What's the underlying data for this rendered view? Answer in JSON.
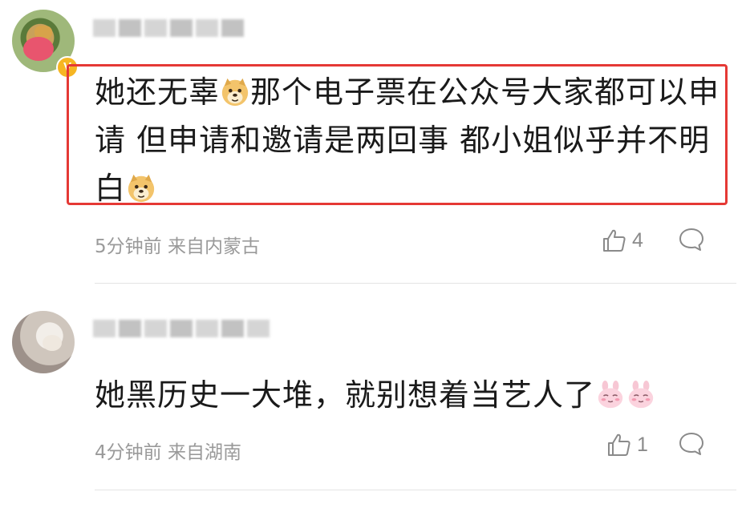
{
  "comments": [
    {
      "text_parts": [
        "她还无辜",
        "那个电子票在公众号大家都可以申请 但申请和邀请是两回事 都小姐似乎并不明白",
        ""
      ],
      "emoji": "doge-emoji",
      "vip_badge": "V",
      "time": "5分钟前",
      "location": "来自内蒙古",
      "likes": "4"
    },
    {
      "text": "她黑历史一大堆，就别想着当艺人了",
      "emoji": "pink-bunny-emoji",
      "time": "4分钟前",
      "location": "来自湖南",
      "likes": "1"
    }
  ],
  "colors": {
    "highlight": "#e53935",
    "meta_text": "#9a9a9a",
    "vip_badge": "#f6b623"
  },
  "icons": {
    "like": "thumbs-up-icon",
    "reply": "speech-bubble-icon"
  }
}
